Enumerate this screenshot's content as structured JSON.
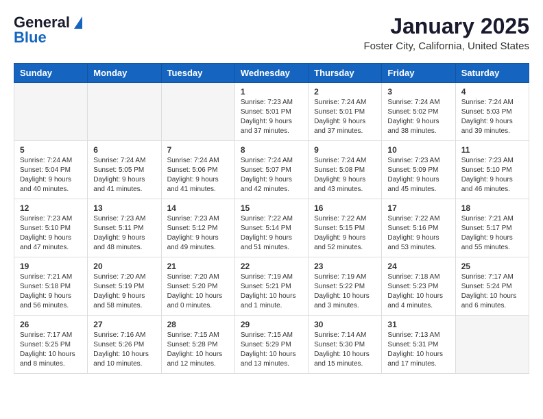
{
  "header": {
    "logo_general": "General",
    "logo_blue": "Blue",
    "month": "January 2025",
    "location": "Foster City, California, United States"
  },
  "weekdays": [
    "Sunday",
    "Monday",
    "Tuesday",
    "Wednesday",
    "Thursday",
    "Friday",
    "Saturday"
  ],
  "weeks": [
    [
      {
        "day": "",
        "empty": true
      },
      {
        "day": "",
        "empty": true
      },
      {
        "day": "",
        "empty": true
      },
      {
        "day": "1",
        "info": "Sunrise: 7:23 AM\nSunset: 5:01 PM\nDaylight: 9 hours and 37 minutes."
      },
      {
        "day": "2",
        "info": "Sunrise: 7:24 AM\nSunset: 5:01 PM\nDaylight: 9 hours and 37 minutes."
      },
      {
        "day": "3",
        "info": "Sunrise: 7:24 AM\nSunset: 5:02 PM\nDaylight: 9 hours and 38 minutes."
      },
      {
        "day": "4",
        "info": "Sunrise: 7:24 AM\nSunset: 5:03 PM\nDaylight: 9 hours and 39 minutes."
      }
    ],
    [
      {
        "day": "5",
        "info": "Sunrise: 7:24 AM\nSunset: 5:04 PM\nDaylight: 9 hours and 40 minutes."
      },
      {
        "day": "6",
        "info": "Sunrise: 7:24 AM\nSunset: 5:05 PM\nDaylight: 9 hours and 41 minutes."
      },
      {
        "day": "7",
        "info": "Sunrise: 7:24 AM\nSunset: 5:06 PM\nDaylight: 9 hours and 41 minutes."
      },
      {
        "day": "8",
        "info": "Sunrise: 7:24 AM\nSunset: 5:07 PM\nDaylight: 9 hours and 42 minutes."
      },
      {
        "day": "9",
        "info": "Sunrise: 7:24 AM\nSunset: 5:08 PM\nDaylight: 9 hours and 43 minutes."
      },
      {
        "day": "10",
        "info": "Sunrise: 7:23 AM\nSunset: 5:09 PM\nDaylight: 9 hours and 45 minutes."
      },
      {
        "day": "11",
        "info": "Sunrise: 7:23 AM\nSunset: 5:10 PM\nDaylight: 9 hours and 46 minutes."
      }
    ],
    [
      {
        "day": "12",
        "info": "Sunrise: 7:23 AM\nSunset: 5:10 PM\nDaylight: 9 hours and 47 minutes."
      },
      {
        "day": "13",
        "info": "Sunrise: 7:23 AM\nSunset: 5:11 PM\nDaylight: 9 hours and 48 minutes."
      },
      {
        "day": "14",
        "info": "Sunrise: 7:23 AM\nSunset: 5:12 PM\nDaylight: 9 hours and 49 minutes."
      },
      {
        "day": "15",
        "info": "Sunrise: 7:22 AM\nSunset: 5:14 PM\nDaylight: 9 hours and 51 minutes."
      },
      {
        "day": "16",
        "info": "Sunrise: 7:22 AM\nSunset: 5:15 PM\nDaylight: 9 hours and 52 minutes."
      },
      {
        "day": "17",
        "info": "Sunrise: 7:22 AM\nSunset: 5:16 PM\nDaylight: 9 hours and 53 minutes."
      },
      {
        "day": "18",
        "info": "Sunrise: 7:21 AM\nSunset: 5:17 PM\nDaylight: 9 hours and 55 minutes."
      }
    ],
    [
      {
        "day": "19",
        "info": "Sunrise: 7:21 AM\nSunset: 5:18 PM\nDaylight: 9 hours and 56 minutes."
      },
      {
        "day": "20",
        "info": "Sunrise: 7:20 AM\nSunset: 5:19 PM\nDaylight: 9 hours and 58 minutes."
      },
      {
        "day": "21",
        "info": "Sunrise: 7:20 AM\nSunset: 5:20 PM\nDaylight: 10 hours and 0 minutes."
      },
      {
        "day": "22",
        "info": "Sunrise: 7:19 AM\nSunset: 5:21 PM\nDaylight: 10 hours and 1 minute."
      },
      {
        "day": "23",
        "info": "Sunrise: 7:19 AM\nSunset: 5:22 PM\nDaylight: 10 hours and 3 minutes."
      },
      {
        "day": "24",
        "info": "Sunrise: 7:18 AM\nSunset: 5:23 PM\nDaylight: 10 hours and 4 minutes."
      },
      {
        "day": "25",
        "info": "Sunrise: 7:17 AM\nSunset: 5:24 PM\nDaylight: 10 hours and 6 minutes."
      }
    ],
    [
      {
        "day": "26",
        "info": "Sunrise: 7:17 AM\nSunset: 5:25 PM\nDaylight: 10 hours and 8 minutes."
      },
      {
        "day": "27",
        "info": "Sunrise: 7:16 AM\nSunset: 5:26 PM\nDaylight: 10 hours and 10 minutes."
      },
      {
        "day": "28",
        "info": "Sunrise: 7:15 AM\nSunset: 5:28 PM\nDaylight: 10 hours and 12 minutes."
      },
      {
        "day": "29",
        "info": "Sunrise: 7:15 AM\nSunset: 5:29 PM\nDaylight: 10 hours and 13 minutes."
      },
      {
        "day": "30",
        "info": "Sunrise: 7:14 AM\nSunset: 5:30 PM\nDaylight: 10 hours and 15 minutes."
      },
      {
        "day": "31",
        "info": "Sunrise: 7:13 AM\nSunset: 5:31 PM\nDaylight: 10 hours and 17 minutes."
      },
      {
        "day": "",
        "empty": true
      }
    ]
  ]
}
